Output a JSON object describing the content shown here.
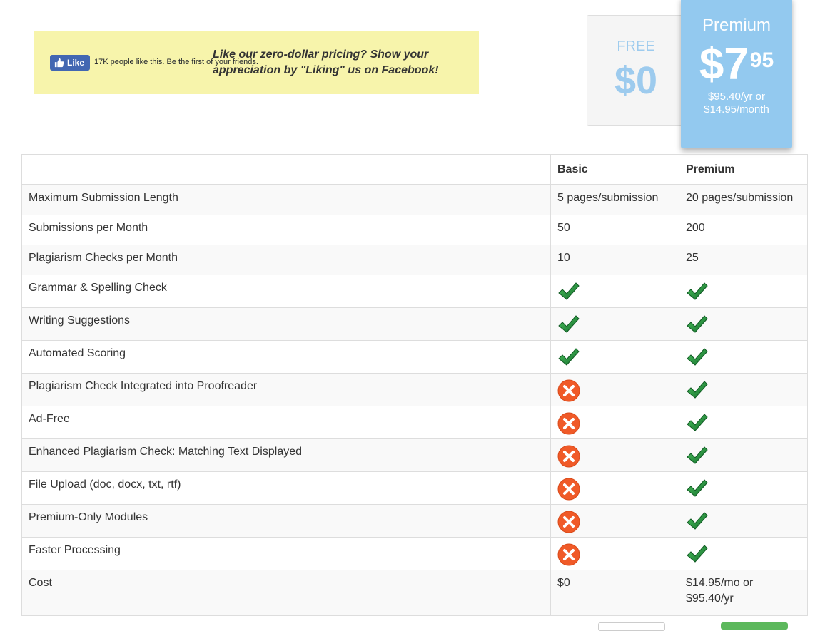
{
  "facebook": {
    "like_label": "Like",
    "like_count_text": "17K people like this. Be the first of your friends.",
    "message": "Like our zero-dollar pricing? Show your appreciation by \"Liking\" us on Facebook!"
  },
  "plans": {
    "free": {
      "name": "FREE",
      "price": "$0"
    },
    "premium": {
      "name": "Premium",
      "price_main": "$7",
      "price_cents": "95",
      "note_line1": "$95.40/yr or",
      "note_line2": "$14.95/month"
    }
  },
  "table": {
    "headers": {
      "feature": "",
      "basic": "Basic",
      "premium": "Premium"
    },
    "rows": [
      {
        "feature": "Maximum Submission Length",
        "basic": "5 pages/submission",
        "premium": "20 pages/submission"
      },
      {
        "feature": "Submissions per Month",
        "basic": "50",
        "premium": "200"
      },
      {
        "feature": "Plagiarism Checks per Month",
        "basic": "10",
        "premium": "25"
      },
      {
        "feature": "Grammar & Spelling Check",
        "basic_icon": "check-icon",
        "premium_icon": "check-icon"
      },
      {
        "feature": "Writing Suggestions",
        "basic_icon": "check-icon",
        "premium_icon": "check-icon"
      },
      {
        "feature": "Automated Scoring",
        "basic_icon": "check-icon",
        "premium_icon": "check-icon"
      },
      {
        "feature": "Plagiarism Check Integrated into Proofreader",
        "basic_icon": "cross-icon",
        "premium_icon": "check-icon"
      },
      {
        "feature": "Ad-Free",
        "basic_icon": "cross-icon",
        "premium_icon": "check-icon"
      },
      {
        "feature": "Enhanced Plagiarism Check: Matching Text Displayed",
        "basic_icon": "cross-icon",
        "premium_icon": "check-icon"
      },
      {
        "feature": "File Upload (doc, docx, txt, rtf)",
        "basic_icon": "cross-icon",
        "premium_icon": "check-icon"
      },
      {
        "feature": "Premium-Only Modules",
        "basic_icon": "cross-icon",
        "premium_icon": "check-icon"
      },
      {
        "feature": "Faster Processing",
        "basic_icon": "cross-icon",
        "premium_icon": "check-icon"
      },
      {
        "feature": "Cost",
        "basic": "$0",
        "premium_line1": "$14.95/mo or",
        "premium_line2": "$95.40/yr"
      }
    ]
  },
  "colors": {
    "check": "#1e8c3a",
    "cross": "#f05a28",
    "premium_card": "#93c9ef",
    "free_text": "#9dcbee",
    "banner": "#f7f4ab"
  }
}
